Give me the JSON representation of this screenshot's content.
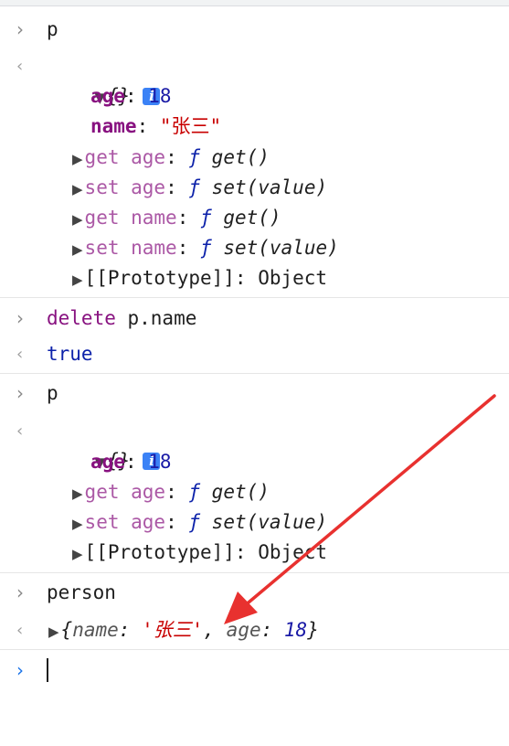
{
  "console": {
    "cmd1": "p",
    "obj1": {
      "brace": "{}",
      "info_icon": "i",
      "age_key": "age",
      "age_val": "18",
      "name_key": "name",
      "name_val": "\"张三\"",
      "get_age": "get age",
      "set_age": "set age",
      "get_name": "get name",
      "set_name": "set name",
      "f": "ƒ",
      "get_fn": "get()",
      "set_fn": "set(value)",
      "proto_key": "[[Prototype]]",
      "proto_val": "Object",
      "colon": ": "
    },
    "cmd2_kw": "delete",
    "cmd2_rest": " p.name",
    "result2": "true",
    "cmd3": "p",
    "cmd4": "person",
    "summary": {
      "open": "{",
      "name_key": "name",
      "name_val": "'张三'",
      "comma": ", ",
      "age_key": "age",
      "age_val": "18",
      "close": "}"
    }
  },
  "colors": {
    "arrow": "#e8312f",
    "info_badge": "#3b82f6"
  },
  "icons": [
    "prompt-chevron-icon",
    "result-chevron-icon",
    "expand-triangle-icon",
    "info-icon",
    "annotation-arrow"
  ]
}
